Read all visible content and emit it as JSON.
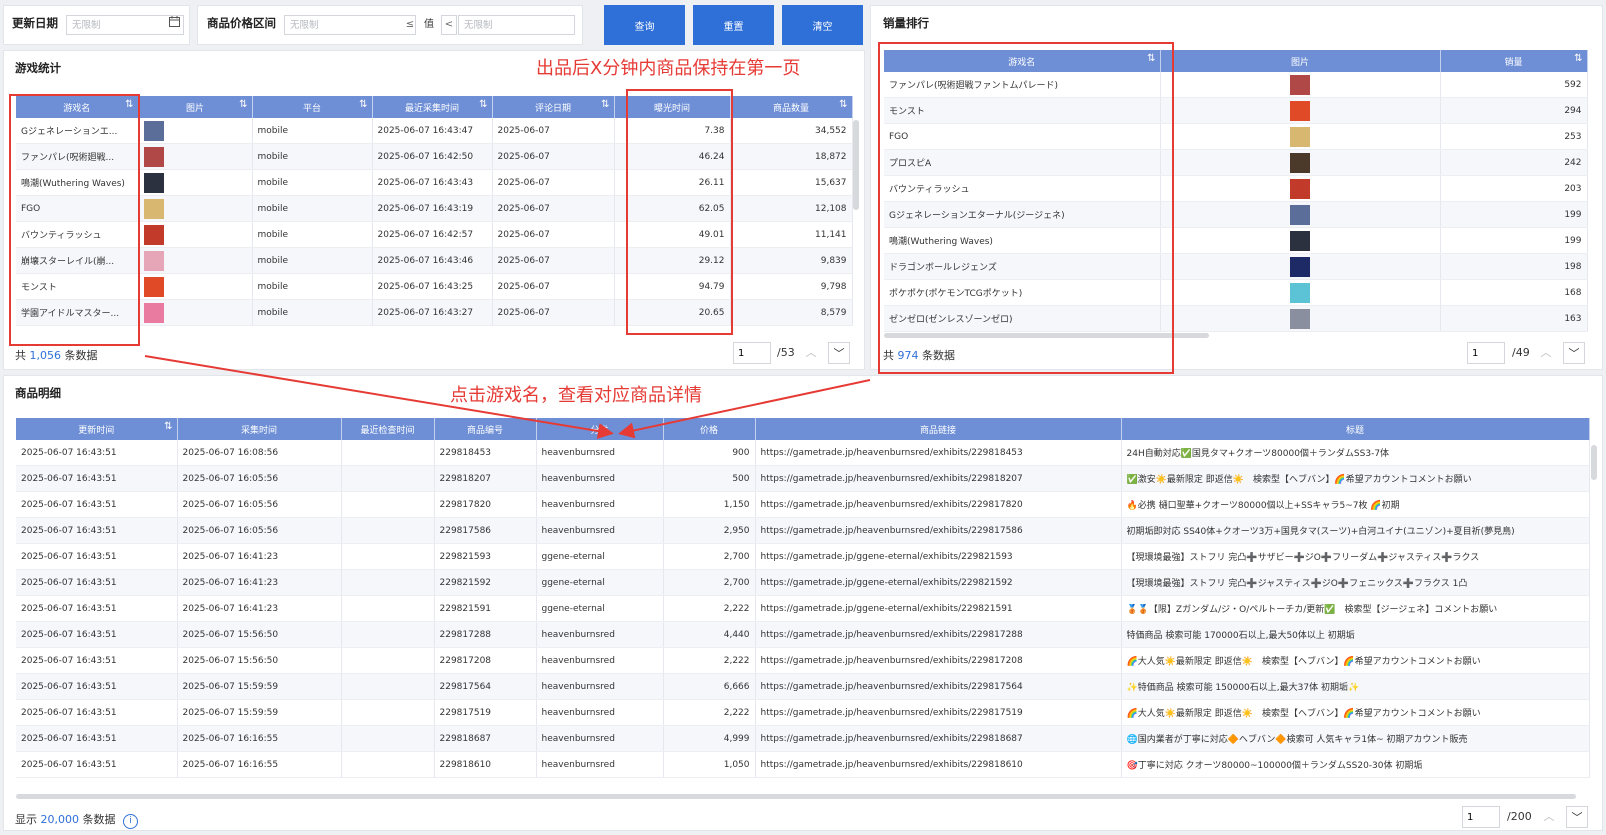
{
  "filters": {
    "update_date_label": "更新日期",
    "update_date_placeholder": "无限制",
    "price_range_label": "商品价格区间",
    "price_min_placeholder": "无限制",
    "price_op_min": "≤",
    "price_value_label": "值",
    "price_op_max": "<",
    "price_max_placeholder": "无限制",
    "query_btn": "查询",
    "reset_btn": "重置",
    "clear_btn": "清空"
  },
  "game_stats": {
    "title": "游戏统计",
    "columns": [
      "游戏名",
      "图片",
      "平台",
      "最近采集时间",
      "评论日期",
      "曝光时间",
      "商品数量"
    ],
    "rows": [
      {
        "name": "Gジェネレーションエ...",
        "platform": "mobile",
        "collected": "2025-06-07 16:43:47",
        "review_date": "2025-06-07",
        "exposure": "7.38",
        "count": "34,552",
        "thumb": "#5b6e9a"
      },
      {
        "name": "ファンパレ(呪術廻戦...",
        "platform": "mobile",
        "collected": "2025-06-07 16:42:50",
        "review_date": "2025-06-07",
        "exposure": "46.24",
        "count": "18,872",
        "thumb": "#b04848"
      },
      {
        "name": "鳴潮(Wuthering Waves)",
        "platform": "mobile",
        "collected": "2025-06-07 16:43:43",
        "review_date": "2025-06-07",
        "exposure": "26.11",
        "count": "15,637",
        "thumb": "#2c3140"
      },
      {
        "name": "FGO",
        "platform": "mobile",
        "collected": "2025-06-07 16:43:19",
        "review_date": "2025-06-07",
        "exposure": "62.05",
        "count": "12,108",
        "thumb": "#d8b870"
      },
      {
        "name": "バウンティラッシュ",
        "platform": "mobile",
        "collected": "2025-06-07 16:42:57",
        "review_date": "2025-06-07",
        "exposure": "49.01",
        "count": "11,141",
        "thumb": "#c23a2a"
      },
      {
        "name": "崩壊スターレイル(崩...",
        "platform": "mobile",
        "collected": "2025-06-07 16:43:46",
        "review_date": "2025-06-07",
        "exposure": "29.12",
        "count": "9,839",
        "thumb": "#e7a6b8"
      },
      {
        "name": "モンスト",
        "platform": "mobile",
        "collected": "2025-06-07 16:43:25",
        "review_date": "2025-06-07",
        "exposure": "94.79",
        "count": "9,798",
        "thumb": "#e04a26"
      },
      {
        "name": "学園アイドルマスター...",
        "platform": "mobile",
        "collected": "2025-06-07 16:43:27",
        "review_date": "2025-06-07",
        "exposure": "20.65",
        "count": "8,579",
        "thumb": "#e97aa0"
      }
    ],
    "total_prefix": "共",
    "total": "1,056",
    "total_suffix": "条数据",
    "page": "1",
    "pages": "/53"
  },
  "sales_rank": {
    "title": "销量排行",
    "columns": [
      "游戏名",
      "图片",
      "销量"
    ],
    "rows": [
      {
        "name": "ファンパレ(呪術廻戦ファントムパレード)",
        "sales": "592",
        "thumb": "#b04848"
      },
      {
        "name": "モンスト",
        "sales": "294",
        "thumb": "#e04a26"
      },
      {
        "name": "FGO",
        "sales": "253",
        "thumb": "#d8b870"
      },
      {
        "name": "プロスピA",
        "sales": "242",
        "thumb": "#4b3a2a"
      },
      {
        "name": "バウンティラッシュ",
        "sales": "203",
        "thumb": "#c23a2a"
      },
      {
        "name": "Gジェネレーションエターナル(ジージェネ)",
        "sales": "199",
        "thumb": "#5b6e9a"
      },
      {
        "name": "鳴潮(Wuthering Waves)",
        "sales": "199",
        "thumb": "#2c3140"
      },
      {
        "name": "ドラゴンボールレジェンズ",
        "sales": "198",
        "thumb": "#1e2a66"
      },
      {
        "name": "ポケポケ(ポケモンTCGポケット)",
        "sales": "168",
        "thumb": "#5cc2d6"
      },
      {
        "name": "ゼンゼロ(ゼンレスゾーンゼロ)",
        "sales": "163",
        "thumb": "#8a8fa0"
      }
    ],
    "total_prefix": "共",
    "total": "974",
    "total_suffix": "条数据",
    "page": "1",
    "pages": "/49"
  },
  "product_detail": {
    "title": "商品明细",
    "columns": [
      "更新时间",
      "采集时间",
      "最近检查时间",
      "商品编号",
      "分类",
      "价格",
      "商品链接",
      "标题"
    ],
    "rows": [
      {
        "updated": "2025-06-07 16:43:51",
        "collected": "2025-06-07 16:08:56",
        "checked": "",
        "id": "229818453",
        "category": "heavenburnsred",
        "price": "900",
        "url": "https://gametrade.jp/heavenburnsred/exhibits/229818453",
        "title": "24H自動対応✅国見タマ+クオーツ80000個＋ランダムSS3-7体"
      },
      {
        "updated": "2025-06-07 16:43:51",
        "collected": "2025-06-07 16:05:56",
        "checked": "",
        "id": "229818207",
        "category": "heavenburnsred",
        "price": "500",
        "url": "https://gametrade.jp/heavenburnsred/exhibits/229818207",
        "title": "✅激安☀️最新限定 即返信☀️　検索型【ヘブバン】🌈希望アカウントコメントお願い"
      },
      {
        "updated": "2025-06-07 16:43:51",
        "collected": "2025-06-07 16:05:56",
        "checked": "",
        "id": "229817820",
        "category": "heavenburnsred",
        "price": "1,150",
        "url": "https://gametrade.jp/heavenburnsred/exhibits/229817820",
        "title": "🔥必携 樋口聖華+クオーツ80000個以上+SSキャラ5~7枚 🌈初期"
      },
      {
        "updated": "2025-06-07 16:43:51",
        "collected": "2025-06-07 16:05:56",
        "checked": "",
        "id": "229817586",
        "category": "heavenburnsred",
        "price": "2,950",
        "url": "https://gametrade.jp/heavenburnsred/exhibits/229817586",
        "title": "初期垢即対応 SS40体+クオーツ3万+国見タマ(スーツ)+白河ユイナ(ユニゾン)+夏目祈(夢見鳥)"
      },
      {
        "updated": "2025-06-07 16:43:51",
        "collected": "2025-06-07 16:41:23",
        "checked": "",
        "id": "229821593",
        "category": "ggene-eternal",
        "price": "2,700",
        "url": "https://gametrade.jp/ggene-eternal/exhibits/229821593",
        "title": "【現環境最強】ストフリ 完凸➕サザビー➕ジO➕フリーダム➕ジャスティス➕ラクス"
      },
      {
        "updated": "2025-06-07 16:43:51",
        "collected": "2025-06-07 16:41:23",
        "checked": "",
        "id": "229821592",
        "category": "ggene-eternal",
        "price": "2,700",
        "url": "https://gametrade.jp/ggene-eternal/exhibits/229821592",
        "title": "【現環境最強】ストフリ 完凸➕ジャスティス➕ジO➕フェニックス➕フラクス 1凸"
      },
      {
        "updated": "2025-06-07 16:43:51",
        "collected": "2025-06-07 16:41:23",
        "checked": "",
        "id": "229821591",
        "category": "ggene-eternal",
        "price": "2,222",
        "url": "https://gametrade.jp/ggene-eternal/exhibits/229821591",
        "title": "🥉🥉【限】Zガンダム/ジ・O/ペルトーチカ/更新✅　検索型【ジージェネ】コメントお願い"
      },
      {
        "updated": "2025-06-07 16:43:51",
        "collected": "2025-06-07 15:56:50",
        "checked": "",
        "id": "229817288",
        "category": "heavenburnsred",
        "price": "4,440",
        "url": "https://gametrade.jp/heavenburnsred/exhibits/229817288",
        "title": "特価商品 検索可能 170000石以上,最大50体以上 初期垢"
      },
      {
        "updated": "2025-06-07 16:43:51",
        "collected": "2025-06-07 15:56:50",
        "checked": "",
        "id": "229817208",
        "category": "heavenburnsred",
        "price": "2,222",
        "url": "https://gametrade.jp/heavenburnsred/exhibits/229817208",
        "title": "🌈大人気☀️最新限定 即返信☀️　検索型【ヘブバン】🌈希望アカウントコメントお願い"
      },
      {
        "updated": "2025-06-07 16:43:51",
        "collected": "2025-06-07 15:59:59",
        "checked": "",
        "id": "229817564",
        "category": "heavenburnsred",
        "price": "6,666",
        "url": "https://gametrade.jp/heavenburnsred/exhibits/229817564",
        "title": "✨特価商品 検索可能 150000石以上,最大37体 初期垢✨"
      },
      {
        "updated": "2025-06-07 16:43:51",
        "collected": "2025-06-07 15:59:59",
        "checked": "",
        "id": "229817519",
        "category": "heavenburnsred",
        "price": "2,222",
        "url": "https://gametrade.jp/heavenburnsred/exhibits/229817519",
        "title": "🌈大人気☀️最新限定 即返信☀️　検索型【ヘブバン】🌈希望アカウントコメントお願い"
      },
      {
        "updated": "2025-06-07 16:43:51",
        "collected": "2025-06-07 16:16:55",
        "checked": "",
        "id": "229818687",
        "category": "heavenburnsred",
        "price": "4,999",
        "url": "https://gametrade.jp/heavenburnsred/exhibits/229818687",
        "title": "🌐国内業者が丁寧に対応🔶ヘブバン🔶検索可 人気キャラ1体~ 初期アカウント販売"
      },
      {
        "updated": "2025-06-07 16:43:51",
        "collected": "2025-06-07 16:16:55",
        "checked": "",
        "id": "229818610",
        "category": "heavenburnsred",
        "price": "1,050",
        "url": "https://gametrade.jp/heavenburnsred/exhibits/229818610",
        "title": "🎯丁寧に対応 クオーツ80000~100000個＋ランダムSS20-30体 初期垢"
      }
    ],
    "total_prefix": "显示",
    "total": "20,000",
    "total_suffix": "条数据",
    "page": "1",
    "pages": "/200"
  },
  "annotations": {
    "top": "出品后X分钟内商品保持在第一页",
    "mid": "点击游戏名，查看对应商品详情"
  },
  "colors": {
    "accent": "#2f6fd8",
    "header": "#6e8fd6",
    "annotation": "#e63a35"
  }
}
